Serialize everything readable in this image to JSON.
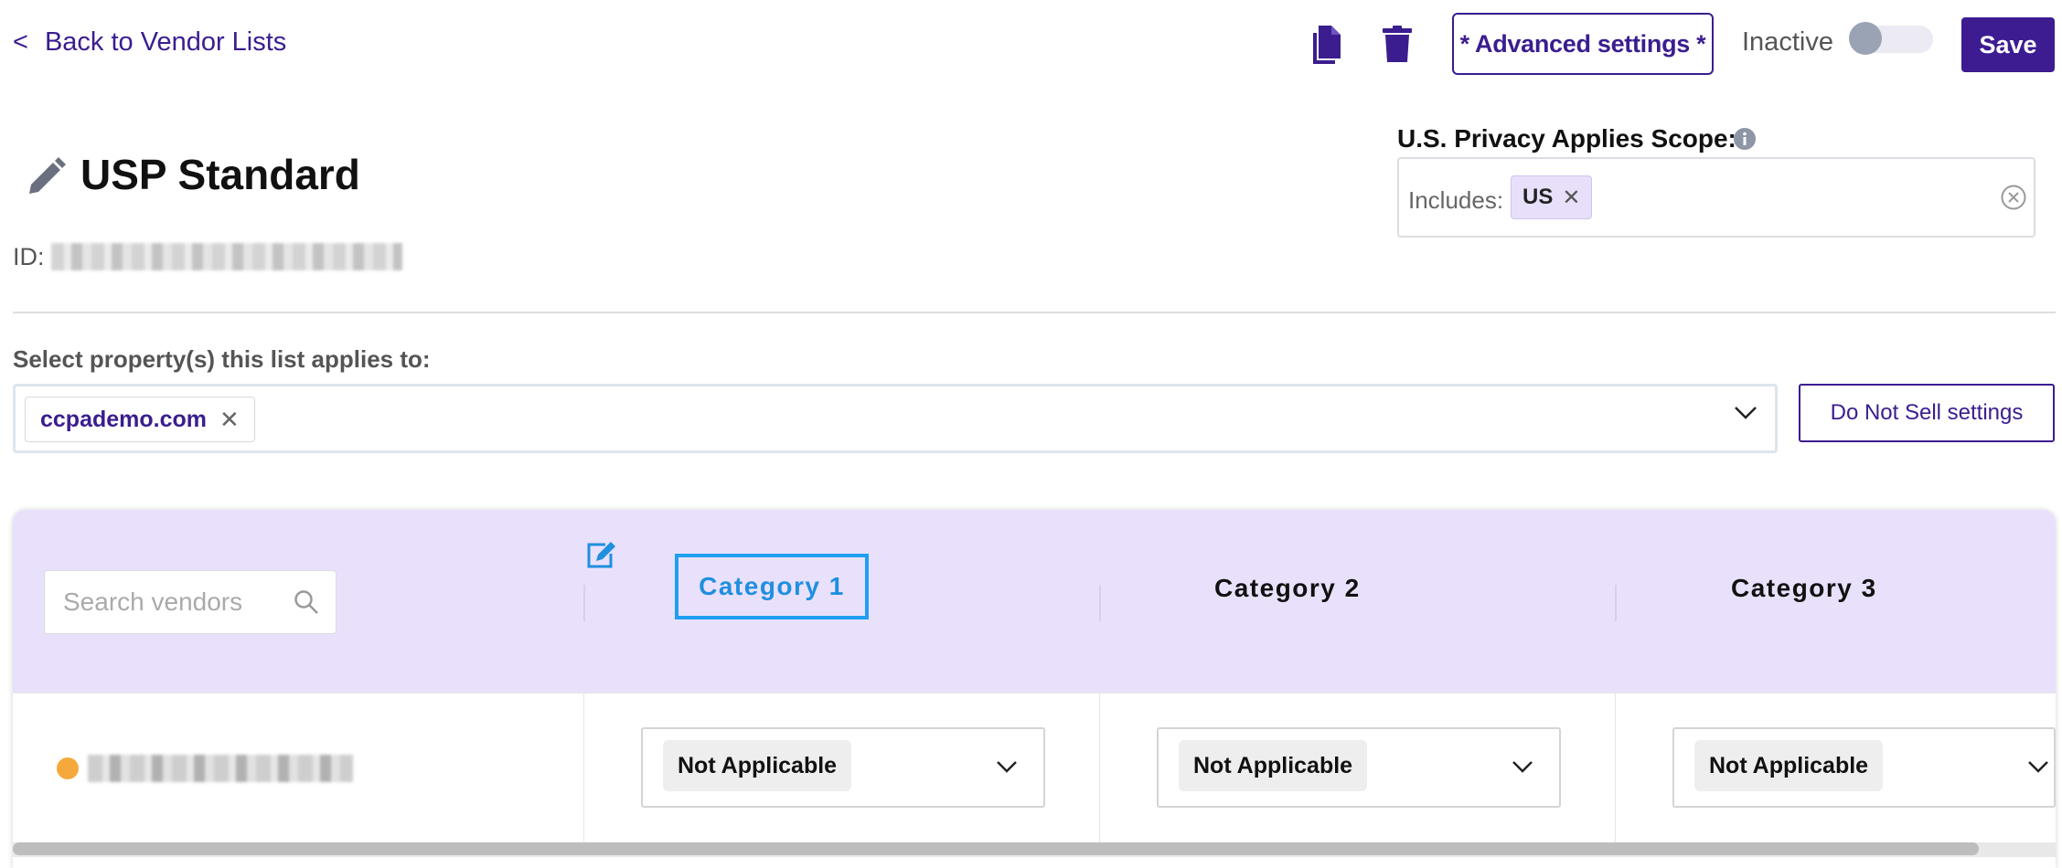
{
  "header": {
    "back_label": "Back to Vendor Lists",
    "back_chevron": "<",
    "copy_icon": "copy-icon",
    "delete_icon": "trash-icon",
    "advanced_label": "* Advanced settings *",
    "status_label": "Inactive",
    "toggle_on": false,
    "save_label": "Save"
  },
  "title": {
    "text": "USP Standard",
    "id_label": "ID:"
  },
  "scope": {
    "label": "U.S. Privacy Applies Scope:",
    "includes_label": "Includes:",
    "tags": [
      "US"
    ]
  },
  "properties": {
    "label": "Select property(s) this list applies to:",
    "tags": [
      "ccpademo.com"
    ],
    "dns_button": "Do Not Sell settings"
  },
  "table": {
    "search_placeholder": "Search vendors",
    "columns": [
      "Category 1",
      "Category 2",
      "Category 3"
    ],
    "rows": [
      {
        "status_color": "#f5a93d",
        "values": [
          "Not Applicable",
          "Not Applicable",
          "Not Applicable"
        ]
      }
    ]
  },
  "colors": {
    "brand": "#3b1d8f",
    "header_bg": "#e9e1fc",
    "focus": "#1f9ff2"
  }
}
